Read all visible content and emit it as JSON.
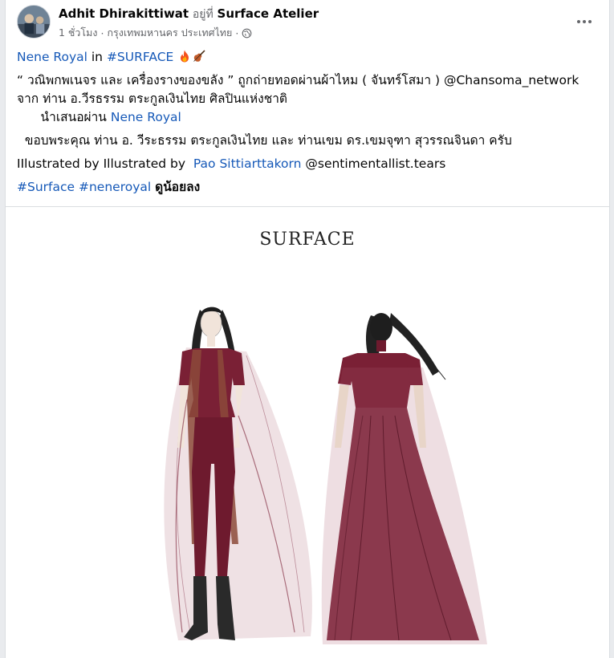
{
  "post": {
    "author": "Adhit Dhirakittiwat",
    "at_text": "อยู่ที่",
    "place": "Surface Atelier",
    "time": "1 ชั่วโมง",
    "separator": "·",
    "location": "กรุงเทพมหานคร ประเทศไทย",
    "separator2": "·"
  },
  "content": {
    "line1_link1": "Nene Royal",
    "line1_in": " in ",
    "line1_hashtag": "#SURFACE",
    "line2": "  “ วณิพกพเนจร และ เครื่องรางของขลัง ” ถูกถ่ายทอดผ่านผ้าไหม ( จันทร์โสมา ) @Chansoma_network",
    "line3": "จาก ท่าน อ.วีรธรรม ตระกูลเงินไทย  ศิลปินแห่งชาติ",
    "line4_prefix": "      นำเสนอผ่าน ",
    "line4_link": "Nene Royal",
    "line5": "  ขอบพระคุณ ท่าน อ. วีระธรรม ตระกูลเงินไทย และ ท่านเขม ดร.เขมจุฑา สุวรรณจินดา ครับ",
    "line6_prefix": "IIlustrated by Illustrated by  ",
    "line6_link": "Pao Sittiarttakorn",
    "line6_suffix": " @sentimentallist.tears",
    "hashtag1": "#Surface",
    "hashtag2": "#neneroyal",
    "see_less": "ดูน้อยลง"
  },
  "image": {
    "title": "SURFACE"
  },
  "colors": {
    "link": "#1659b8",
    "dress": "#7a2035",
    "muted": "#65676b"
  }
}
